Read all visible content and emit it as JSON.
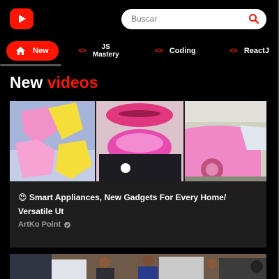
{
  "header": {
    "logo_icon": "youtube-play-icon",
    "search_placeholder": "Buscar",
    "search_icon": "search-icon",
    "accent_color": "#fc1503"
  },
  "categories": [
    {
      "label": "New",
      "icon": "home-icon",
      "active": true
    },
    {
      "label_line1": "JS",
      "label_line2": "Mastery",
      "icon": "code-icon"
    },
    {
      "label": "Coding",
      "icon": "code-icon"
    },
    {
      "label": "ReactJ",
      "icon": "code-icon"
    }
  ],
  "section": {
    "title_white": "New",
    "title_red": "videos"
  },
  "videos": [
    {
      "title_emoji": "😍",
      "title": "Smart Appliances, New Gadgets For Every Home/ Versatile Ut",
      "channel": "ArtKo Point",
      "verified_icon": "check-circle-icon"
    }
  ]
}
